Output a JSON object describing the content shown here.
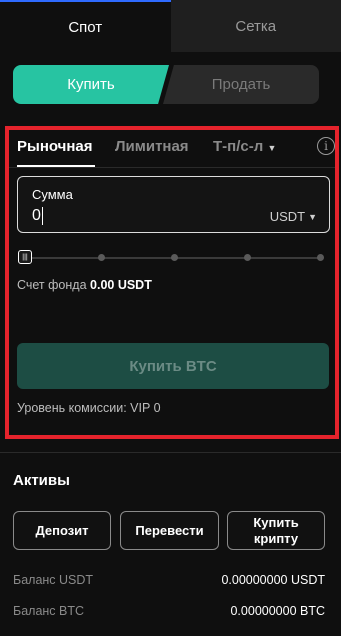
{
  "top_tabs": [
    {
      "label": "Спот",
      "active": true
    },
    {
      "label": "Сетка",
      "active": false
    }
  ],
  "side": {
    "buy_label": "Купить",
    "sell_label": "Продать"
  },
  "order_types": [
    {
      "label": "Рыночная",
      "active": true
    },
    {
      "label": "Лимитная",
      "active": false
    },
    {
      "label": "Т-п/с-л",
      "active": false
    }
  ],
  "amount": {
    "label": "Сумма",
    "value": "0",
    "unit": "USDT"
  },
  "slider": {
    "value_percent": 0,
    "stops": 5
  },
  "fund": {
    "label": "Счет фонда",
    "value": "0.00 USDT"
  },
  "buy_button_label": "Купить BTC",
  "fee": {
    "text": "Уровень комиссии: VIP 0"
  },
  "assets": {
    "title": "Активы",
    "buttons": [
      {
        "label": "Депозит"
      },
      {
        "label": "Перевести"
      },
      {
        "label": "Купить\nкрипту"
      }
    ],
    "balances": [
      {
        "label": "Баланс USDT",
        "value": "0.00000000 USDT"
      },
      {
        "label": "Баланс BTC",
        "value": "0.00000000 BTC"
      }
    ]
  },
  "colors": {
    "accent_buy": "#27c4a2",
    "highlight_border": "#e5232c",
    "tab_indicator": "#2f6bff"
  },
  "icons": [
    "info-icon",
    "caret-down-icon",
    "slider-handle-icon"
  ]
}
